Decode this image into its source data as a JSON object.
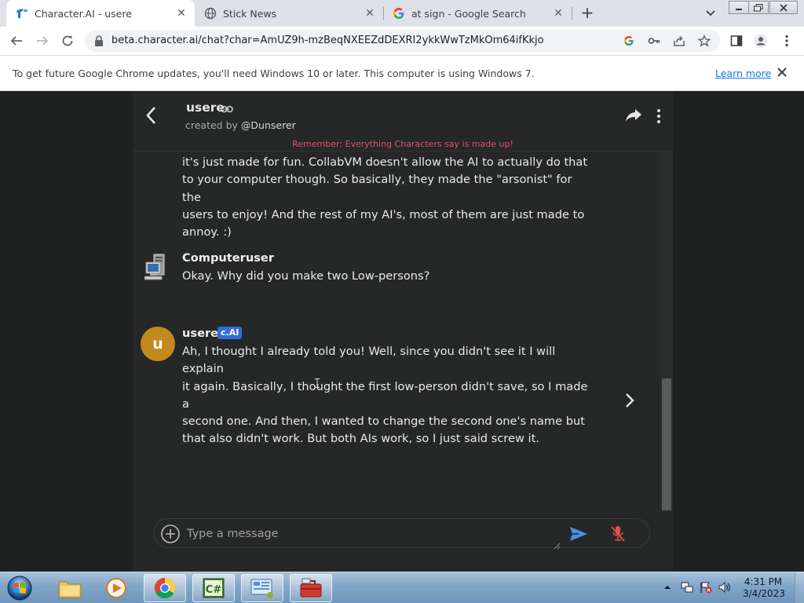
{
  "browser": {
    "tabs": [
      {
        "title": "Character.AI - usere",
        "active": true
      },
      {
        "title": "Stick News",
        "active": false
      },
      {
        "title": "at sign - Google Search",
        "active": false
      }
    ],
    "url": "beta.character.ai/chat?char=AmUZ9h-mzBeqNXEEZdDEXRI2ykkWwTzMkOm64ifKkjo",
    "infobar": {
      "message": "To get future Google Chrome updates, you'll need Windows 10 or later. This computer is using Windows 7.",
      "link": "Learn more"
    }
  },
  "chat": {
    "character_name": "usere",
    "created_by_prefix": "created by",
    "creator": "@Dunserer",
    "disclaimer": "Remember: Everything Characters say is made up!",
    "messages": [
      {
        "sender": "",
        "lines": [
          "it's just made for fun. CollabVM doesn't allow the AI to actually do that",
          "to your computer though. So basically, they made the \"arsonist\" for the",
          "users to enjoy! And the rest of my AI's, most of them are just made to",
          "annoy. :)"
        ]
      },
      {
        "sender": "Computeruser",
        "lines": [
          "Okay. Why did you make two Low-persons?"
        ]
      },
      {
        "sender": "usere",
        "badge": "c.AI",
        "avatar_letter": "u",
        "lines": [
          "Ah, I thought I already told you! Well, since you didn't see it I will explain",
          "it again. Basically, I thought the first low-person didn't save, so I made a",
          "second one. And then, I wanted to change the second one's name but",
          "that also didn't work. But both AIs work, so I just said screw it."
        ]
      }
    ],
    "composer_placeholder": "Type a message"
  },
  "taskbar": {
    "time": "4:31 PM",
    "date": "3/4/2023"
  },
  "colors": {
    "page_bg": "#1f2020",
    "panel_bg": "#262727",
    "disclaimer": "#e0556a",
    "badge": "#2f6fd6",
    "avatar": "#c28a1e",
    "send": "#4a90e2",
    "mic_muted": "#e05050"
  }
}
